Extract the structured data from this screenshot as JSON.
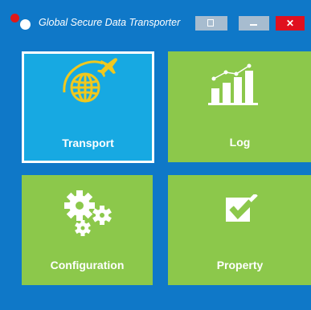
{
  "window": {
    "title": "Global Secure Data Transporter",
    "close_label": "✕"
  },
  "tiles": [
    {
      "label": "Transport",
      "icon": "globe-airplane-icon",
      "selected": true
    },
    {
      "label": "Log",
      "icon": "bar-chart-icon",
      "selected": false
    },
    {
      "label": "Configuration",
      "icon": "gears-icon",
      "selected": false
    },
    {
      "label": "Property",
      "icon": "checkbox-icon",
      "selected": false
    }
  ],
  "colors": {
    "background": "#0f78c8",
    "tile": "#8cc84b",
    "tile_selected": "#17a9e2",
    "icon_yellow": "#f0c81e",
    "close_button": "#e0101e"
  }
}
